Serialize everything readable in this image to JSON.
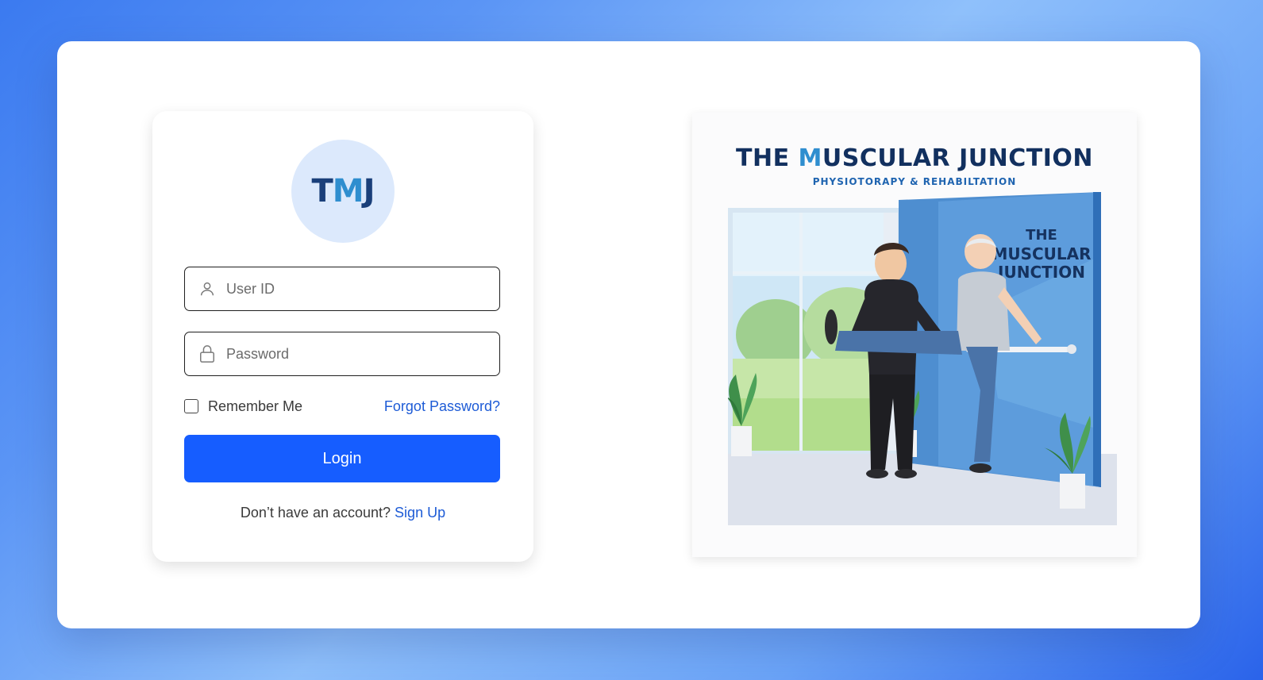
{
  "logo": {
    "text_before": "T",
    "text_m": "M",
    "text_after": "J"
  },
  "login_form": {
    "userid_placeholder": "User ID",
    "password_placeholder": "Password",
    "remember_label": "Remember Me",
    "forgot_label": "Forgot Password?",
    "login_label": "Login",
    "signup_prompt": "Don’t have an account?",
    "signup_label": "Sign Up"
  },
  "promo": {
    "title_before": "THE ",
    "title_m": "M",
    "title_after": "USCULAR JUNCTION",
    "subtitle": "PHYSIOTORAPY & REHABILTATION",
    "wall_line1": "THE",
    "wall_line2": "MUSCULAR",
    "wall_line3": "JUNCTION"
  },
  "colors": {
    "primary": "#165dff",
    "link": "#1d5bd6",
    "logo_bg": "#dce9fc",
    "brand_navy": "#12305f",
    "brand_blue": "#2f8ecf"
  },
  "icons": {
    "userid_icon": "user-icon",
    "password_icon": "lock-icon"
  }
}
